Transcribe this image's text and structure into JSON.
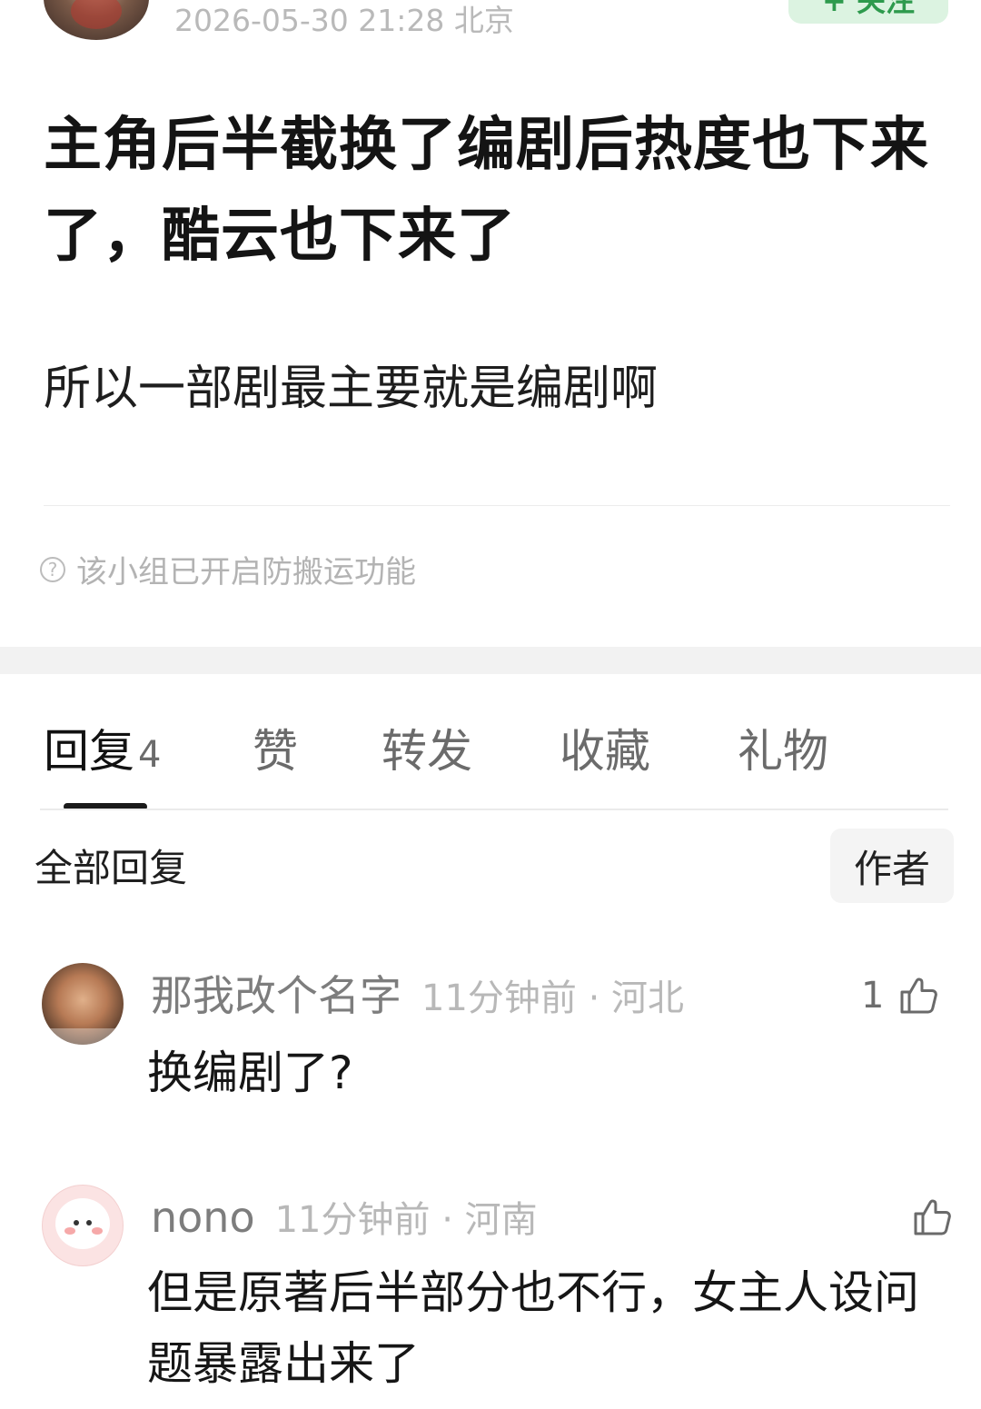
{
  "post": {
    "meta": "2026-05-30 21:28 北京",
    "follow_label": "+ 关注",
    "title": "主角后半截换了编剧后热度也下来了，酷云也下来了",
    "body": "所以一部剧最主要就是编剧啊",
    "notice": "该小组已开启防搬运功能"
  },
  "tabs": {
    "reply_label": "回复",
    "reply_count": "4",
    "like_label": "赞",
    "repost_label": "转发",
    "favorite_label": "收藏",
    "gift_label": "礼物"
  },
  "replies_header": {
    "all_label": "全部回复",
    "author_filter_label": "作者"
  },
  "comments": [
    {
      "name": "那我改个名字",
      "meta": "11分钟前 · 河北",
      "likes": "1",
      "text": "换编剧了?"
    },
    {
      "name": "nono",
      "meta": "11分钟前 · 河南",
      "likes": "",
      "text": "但是原著后半部分也不行，女主人设问题暴露出来了"
    }
  ]
}
